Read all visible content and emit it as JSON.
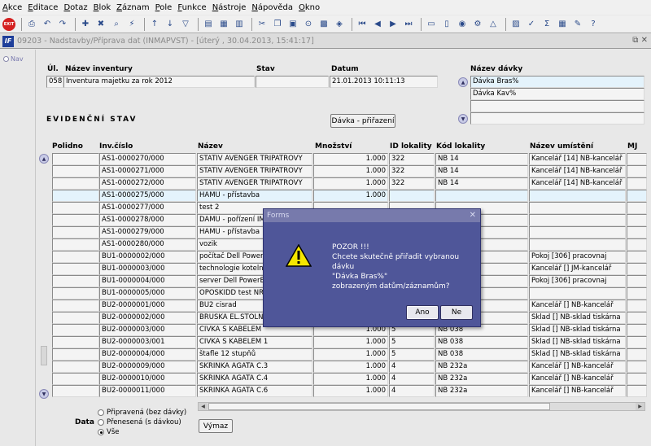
{
  "menu": [
    "Akce",
    "Editace",
    "Dotaz",
    "Blok",
    "Záznam",
    "Pole",
    "Funkce",
    "Nástroje",
    "Nápověda",
    "Okno"
  ],
  "toolbar": {
    "exit_label": "EXIT"
  },
  "window": {
    "title": "09203 - Nadstavby/Příprava dat (INMAPVST) - [úterý , 30.04.2013, 15:41:17]",
    "restore_icon": "restore-icon",
    "close_icon": "close-icon"
  },
  "nav": {
    "label": "Nav"
  },
  "inventura": {
    "headers": {
      "ul": "Úl.",
      "nazev": "Název inventury",
      "stav": "Stav",
      "datum": "Datum"
    },
    "ul": "058",
    "nazev": "Inventura majetku za rok 2012",
    "stav": "",
    "datum": "21.01.2013 10:11:13"
  },
  "davky": {
    "header": "Název dávky",
    "items": [
      "Dávka Bras%",
      "Dávka Kav%",
      "",
      ""
    ]
  },
  "section": {
    "title": "EVIDENČNÍ STAV",
    "assign_button": "Dávka - přiřazení"
  },
  "table": {
    "headers": {
      "polidno": "Polidno",
      "inv": "Inv.číslo",
      "nazev": "Název",
      "mnozstvi": "Množství",
      "id_lok": "ID lokality",
      "kod_lok": "Kód lokality",
      "umisteni": "Název umístění",
      "mj": "MJ"
    },
    "rows": [
      {
        "inv": "AS1-0000270/000",
        "nazev": "STATIV AVENGER TRIPATROVY",
        "mnozstvi": "1.000",
        "id": "322",
        "kod": "NB 14",
        "um": "Kancelář [14] NB-kancelář"
      },
      {
        "inv": "AS1-0000271/000",
        "nazev": "STATIV AVENGER TRIPATROVY",
        "mnozstvi": "1.000",
        "id": "322",
        "kod": "NB 14",
        "um": "Kancelář [14] NB-kancelář"
      },
      {
        "inv": "AS1-0000272/000",
        "nazev": "STATIV AVENGER TRIPATROVY",
        "mnozstvi": "1.000",
        "id": "322",
        "kod": "NB 14",
        "um": "Kancelář [14] NB-kancelář"
      },
      {
        "inv": "AS1-0000275/000",
        "nazev": "HAMU - přístavba",
        "mnozstvi": "1.000",
        "id": "",
        "kod": "",
        "um": ""
      },
      {
        "inv": "AS1-0000277/000",
        "nazev": "test 2",
        "mnozstvi": "",
        "id": "",
        "kod": "",
        "um": ""
      },
      {
        "inv": "AS1-0000278/000",
        "nazev": "DAMU - pořízení IM",
        "mnozstvi": "",
        "id": "",
        "kod": "",
        "um": ""
      },
      {
        "inv": "AS1-0000279/000",
        "nazev": "HAMU - přístavba",
        "mnozstvi": "",
        "id": "",
        "kod": "",
        "um": ""
      },
      {
        "inv": "AS1-0000280/000",
        "nazev": "vozik",
        "mnozstvi": "",
        "id": "",
        "kod": "",
        "um": ""
      },
      {
        "inv": "BU1-0000002/000",
        "nazev": "počítač Dell PowerEdge",
        "mnozstvi": "",
        "id": "",
        "kod": "",
        "um": "Pokoj [306] pracovnaj"
      },
      {
        "inv": "BU1-0000003/000",
        "nazev": "technologie kotelny",
        "mnozstvi": "",
        "id": "",
        "kod": "",
        "um": "Kancelář [] JM-kancelář"
      },
      {
        "inv": "BU1-0000004/000",
        "nazev": "server Dell PowerEdge",
        "mnozstvi": "",
        "id": "",
        "kod": "",
        "um": "Pokoj [306] pracovnaj"
      },
      {
        "inv": "BU1-0000005/000",
        "nazev": "OPOSKIDD test NR",
        "mnozstvi": "",
        "id": "",
        "kod": "",
        "um": ""
      },
      {
        "inv": "BU2-0000001/000",
        "nazev": "BU2 cisrad",
        "mnozstvi": "",
        "id": "",
        "kod": "",
        "um": "Kancelář [] NB-kancelář"
      },
      {
        "inv": "BU2-0000002/000",
        "nazev": "BRUSKA EL.STOLNI",
        "mnozstvi": "",
        "id": "",
        "kod": "",
        "um": "Sklad [] NB-sklad tiskárna"
      },
      {
        "inv": "BU2-0000003/000",
        "nazev": "CIVKA S KABELEM",
        "mnozstvi": "1.000",
        "id": "5",
        "kod": "NB 038",
        "um": "Sklad [] NB-sklad tiskárna"
      },
      {
        "inv": "BU2-0000003/001",
        "nazev": "CIVKA S KABELEM 1",
        "mnozstvi": "1.000",
        "id": "5",
        "kod": "NB 038",
        "um": "Sklad [] NB-sklad tiskárna"
      },
      {
        "inv": "BU2-0000004/000",
        "nazev": "štafle 12 stupňů",
        "mnozstvi": "1.000",
        "id": "5",
        "kod": "NB 038",
        "um": "Sklad [] NB-sklad tiskárna"
      },
      {
        "inv": "BU2-0000009/000",
        "nazev": "SKRINKA AGATA C.3",
        "mnozstvi": "1.000",
        "id": "4",
        "kod": "NB 232a",
        "um": "Kancelář [] NB-kancelář"
      },
      {
        "inv": "BU2-0000010/000",
        "nazev": "SKRINKA AGATA C.4",
        "mnozstvi": "1.000",
        "id": "4",
        "kod": "NB 232a",
        "um": "Kancelář [] NB-kancelář"
      },
      {
        "inv": "BU2-0000011/000",
        "nazev": "SKRINKA AGATA C.6",
        "mnozstvi": "1.000",
        "id": "4",
        "kod": "NB 232a",
        "um": "Kancelář [] NB-kancelář"
      }
    ]
  },
  "filter": {
    "label": "Data",
    "options": [
      "Připravená (bez dávky)",
      "Přenesená (s dávkou)",
      "Vše"
    ],
    "selected": "Vše",
    "export_button": "Výmaz"
  },
  "modal": {
    "title": "Forms",
    "close": "✕",
    "lines": [
      "POZOR !!!",
      "Chcete skutečně přiřadit vybranou dávku",
      "\"Dávka Bras%\"",
      "zobrazeným datům/záznamům?"
    ],
    "yes": "Ano",
    "no": "Ne"
  },
  "colors": {
    "modal_bg": "#4f5699",
    "selected_row": "#e4f3fc"
  }
}
